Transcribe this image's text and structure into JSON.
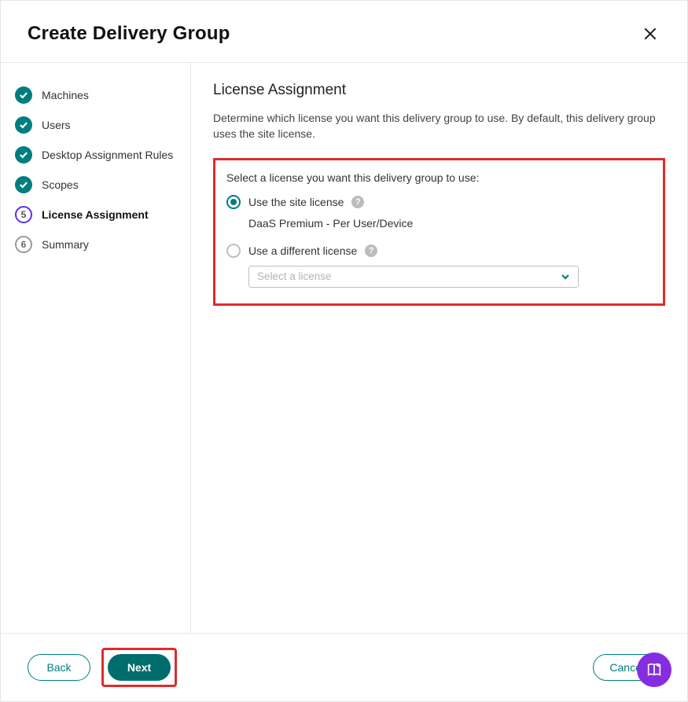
{
  "header": {
    "title": "Create Delivery Group"
  },
  "sidebar": {
    "steps": [
      {
        "label": "Machines",
        "state": "done"
      },
      {
        "label": "Users",
        "state": "done"
      },
      {
        "label": "Desktop Assignment Rules",
        "state": "done"
      },
      {
        "label": "Scopes",
        "state": "done"
      },
      {
        "label": "License Assignment",
        "state": "active",
        "number": "5"
      },
      {
        "label": "Summary",
        "state": "pending",
        "number": "6"
      }
    ]
  },
  "main": {
    "title": "License Assignment",
    "description": "Determine which license you want this delivery group to use. By default, this delivery group uses the site license.",
    "select_label": "Select a license you want this delivery group to use:",
    "options": {
      "site": {
        "label": "Use the site license",
        "detail": "DaaS Premium - Per User/Device",
        "selected": true
      },
      "different": {
        "label": "Use a different license",
        "selected": false,
        "dropdown_placeholder": "Select a license"
      }
    }
  },
  "footer": {
    "back": "Back",
    "next": "Next",
    "cancel": "Cancel"
  }
}
